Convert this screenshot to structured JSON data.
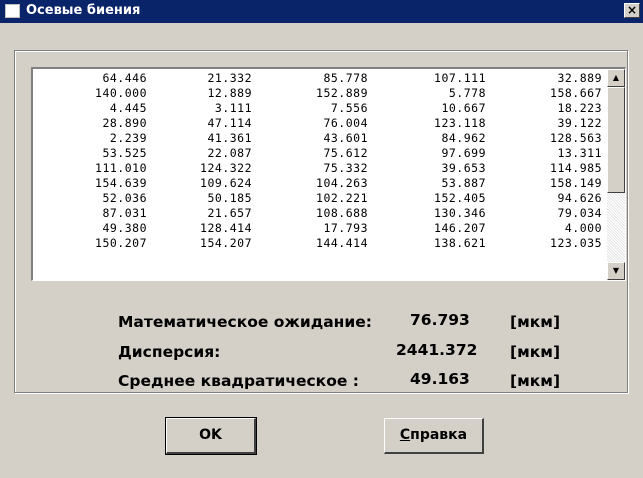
{
  "window": {
    "title": "Осевые биения",
    "close_label": "×"
  },
  "table": {
    "rows": [
      [
        "64.446",
        "21.332",
        "85.778",
        "107.111",
        "32.889"
      ],
      [
        "140.000",
        "12.889",
        "152.889",
        "5.778",
        "158.667"
      ],
      [
        "4.445",
        "3.111",
        "7.556",
        "10.667",
        "18.223"
      ],
      [
        "28.890",
        "47.114",
        "76.004",
        "123.118",
        "39.122"
      ],
      [
        "2.239",
        "41.361",
        "43.601",
        "84.962",
        "128.563"
      ],
      [
        "53.525",
        "22.087",
        "75.612",
        "97.699",
        "13.311"
      ],
      [
        "111.010",
        "124.322",
        "75.332",
        "39.653",
        "114.985"
      ],
      [
        "154.639",
        "109.624",
        "104.263",
        "53.887",
        "158.149"
      ],
      [
        "52.036",
        "50.185",
        "102.221",
        "152.405",
        "94.626"
      ],
      [
        "87.031",
        "21.657",
        "108.688",
        "130.346",
        "79.034"
      ],
      [
        "49.380",
        "128.414",
        "17.793",
        "146.207",
        "4.000"
      ],
      [
        "150.207",
        "154.207",
        "144.414",
        "138.621",
        "123.035"
      ]
    ],
    "scroll_up_icon": "triangle-up",
    "scroll_down_icon": "triangle-down"
  },
  "stats": {
    "mean": {
      "label": "Математическое ожидание:",
      "value": "76.793",
      "unit": "[мкм]"
    },
    "variance": {
      "label": "Дисперсия:",
      "value": "2441.372",
      "unit": "[мкм]"
    },
    "stddev": {
      "label": "Среднее квадратическое :",
      "value": "49.163",
      "unit": "[мкм]"
    }
  },
  "buttons": {
    "ok": "OK",
    "help_first": "С",
    "help_rest": "правка"
  },
  "colors": {
    "titlebar": "#0a246a",
    "face": "#d4d0c8"
  }
}
